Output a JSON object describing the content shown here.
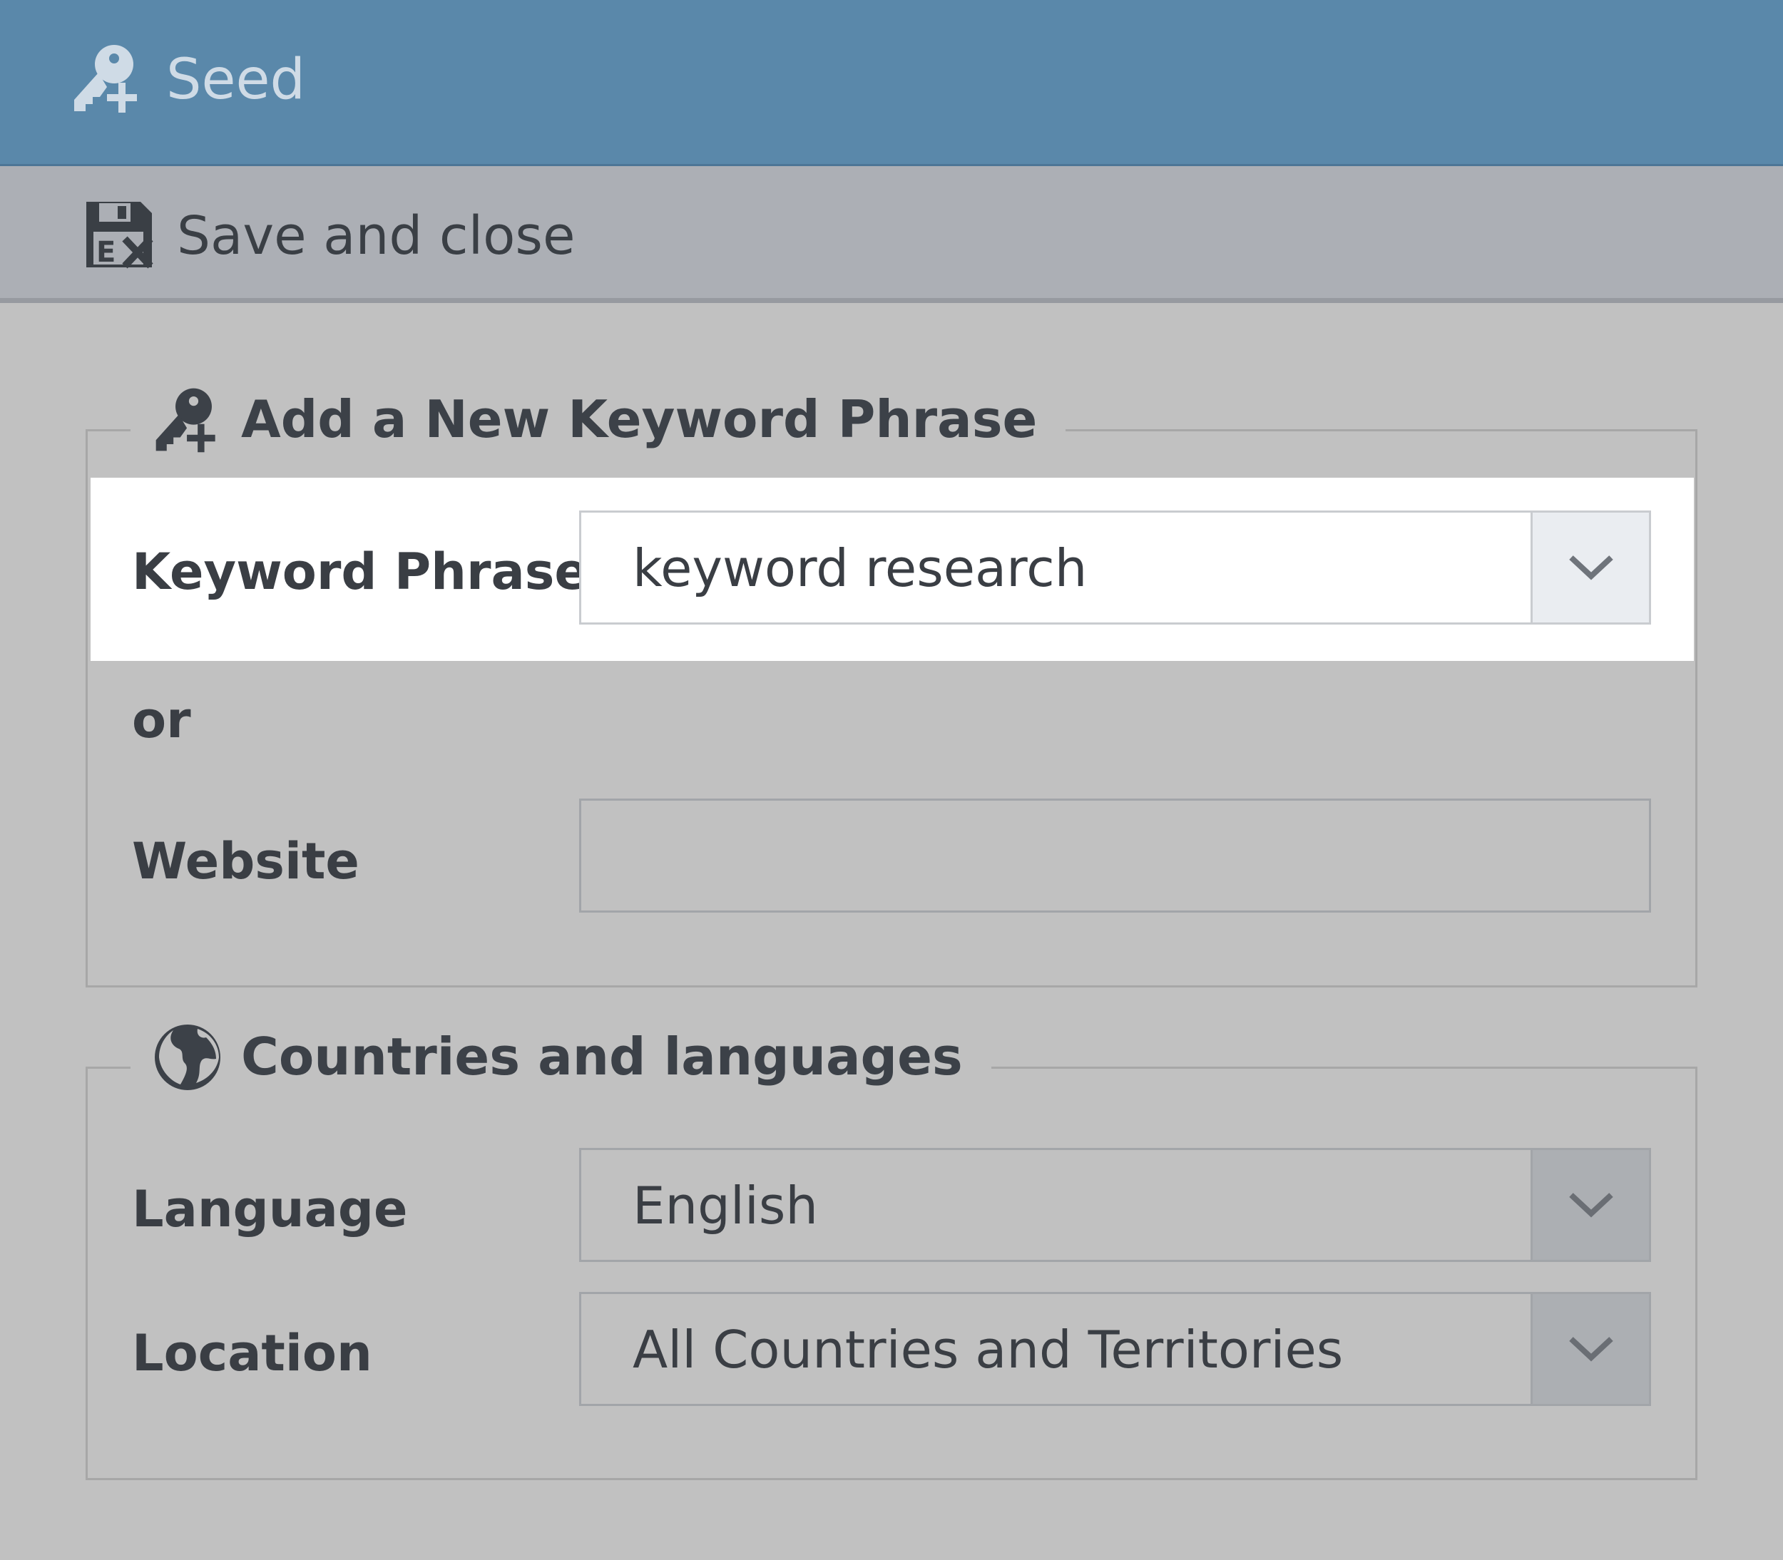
{
  "window": {
    "title": "Seed",
    "title_icon": "key-plus-icon"
  },
  "toolbar": {
    "save_close_label": "Save and close",
    "save_close_icon": "floppy-disk-close-icon"
  },
  "keyword_group": {
    "legend": "Add a New Keyword Phrase",
    "legend_icon": "key-plus-icon",
    "keyword_label": "Keyword Phrase",
    "keyword_value": "keyword research",
    "or_label": "or",
    "website_label": "Website",
    "website_value": ""
  },
  "country_group": {
    "legend": "Countries and languages",
    "legend_icon": "globe-icon",
    "language_label": "Language",
    "language_value": "English",
    "location_label": "Location",
    "location_value": "All Countries and Territories"
  },
  "colors": {
    "titlebar": "#5a88aa",
    "toolbar": "#acafb5",
    "background": "#c1c1c1",
    "highlight": "#ffffff",
    "text": "#3c4148"
  }
}
